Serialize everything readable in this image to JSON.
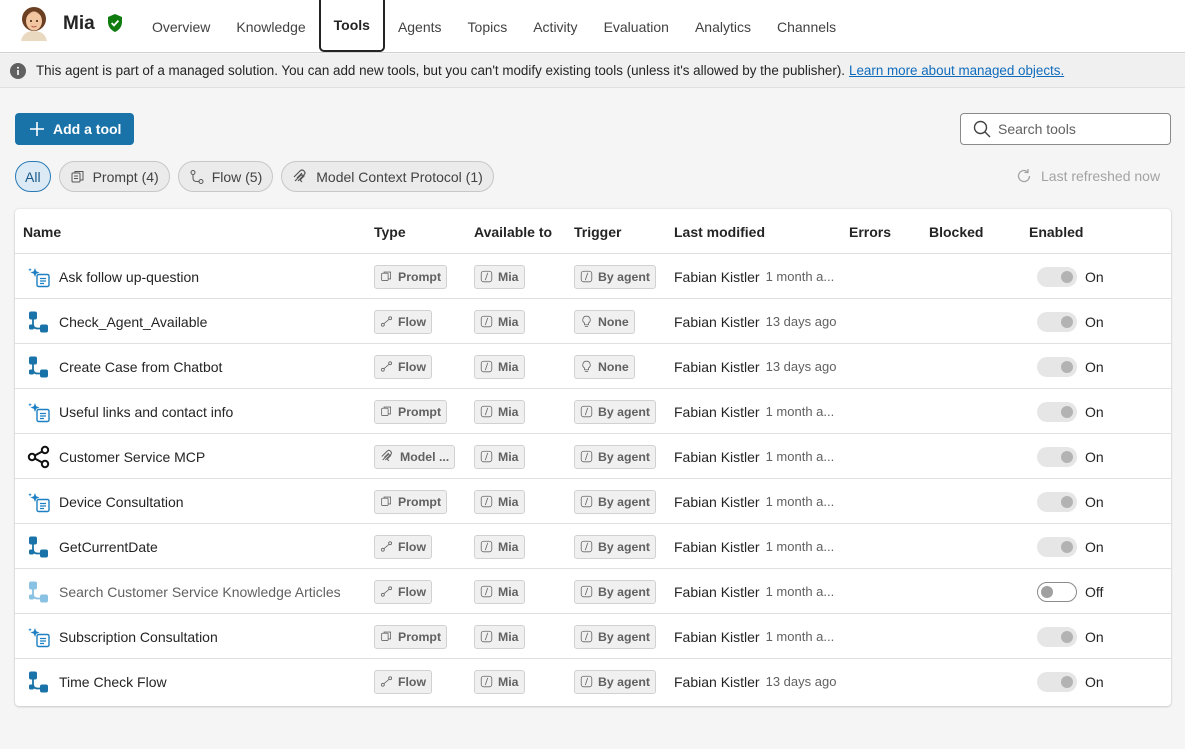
{
  "header": {
    "agent_name": "Mia",
    "tabs": [
      {
        "label": "Overview"
      },
      {
        "label": "Knowledge"
      },
      {
        "label": "Tools",
        "active": true
      },
      {
        "label": "Agents"
      },
      {
        "label": "Topics"
      },
      {
        "label": "Activity"
      },
      {
        "label": "Evaluation"
      },
      {
        "label": "Analytics"
      },
      {
        "label": "Channels"
      }
    ]
  },
  "banner": {
    "text": "This agent is part of a managed solution. You can add new tools, but you can't modify existing tools (unless it's allowed by the publisher).",
    "link": "Learn more about managed objects."
  },
  "toolbar": {
    "add_label": "Add a tool",
    "search_placeholder": "Search tools",
    "refreshed": "Last refreshed now"
  },
  "filters": {
    "all": "All",
    "prompt": "Prompt (4)",
    "flow": "Flow (5)",
    "mcp": "Model Context Protocol (1)"
  },
  "table": {
    "columns": {
      "name": "Name",
      "type": "Type",
      "available": "Available to",
      "trigger": "Trigger",
      "modified": "Last modified",
      "errors": "Errors",
      "blocked": "Blocked",
      "enabled": "Enabled"
    },
    "rows": [
      {
        "icon": "prompt-icon",
        "name": "Ask follow up-question",
        "type": "Prompt",
        "available": "Mia",
        "trigger": "By agent",
        "modified_by": "Fabian Kistler",
        "modified_ago": "1 month a...",
        "enabled": "On"
      },
      {
        "icon": "flow-icon",
        "name": "Check_Agent_Available",
        "type": "Flow",
        "available": "Mia",
        "trigger": "None",
        "modified_by": "Fabian Kistler",
        "modified_ago": "13 days ago",
        "enabled": "On"
      },
      {
        "icon": "flow-icon",
        "name": "Create Case from Chatbot",
        "type": "Flow",
        "available": "Mia",
        "trigger": "None",
        "modified_by": "Fabian Kistler",
        "modified_ago": "13 days ago",
        "enabled": "On"
      },
      {
        "icon": "prompt-icon",
        "name": "Useful links and contact info",
        "type": "Prompt",
        "available": "Mia",
        "trigger": "By agent",
        "modified_by": "Fabian Kistler",
        "modified_ago": "1 month a...",
        "enabled": "On"
      },
      {
        "icon": "mcp-icon",
        "name": "Customer Service MCP",
        "type": "Model ...",
        "available": "Mia",
        "trigger": "By agent",
        "modified_by": "Fabian Kistler",
        "modified_ago": "1 month a...",
        "enabled": "On"
      },
      {
        "icon": "prompt-icon",
        "name": "Device Consultation",
        "type": "Prompt",
        "available": "Mia",
        "trigger": "By agent",
        "modified_by": "Fabian Kistler",
        "modified_ago": "1 month a...",
        "enabled": "On"
      },
      {
        "icon": "flow-icon",
        "name": "GetCurrentDate",
        "type": "Flow",
        "available": "Mia",
        "trigger": "By agent",
        "modified_by": "Fabian Kistler",
        "modified_ago": "1 month a...",
        "enabled": "On"
      },
      {
        "icon": "flow-icon",
        "name": "Search Customer Service Knowledge Articles",
        "type": "Flow",
        "available": "Mia",
        "trigger": "By agent",
        "modified_by": "Fabian Kistler",
        "modified_ago": "1 month a...",
        "enabled": "Off",
        "disabled": true
      },
      {
        "icon": "prompt-icon",
        "name": "Subscription Consultation",
        "type": "Prompt",
        "available": "Mia",
        "trigger": "By agent",
        "modified_by": "Fabian Kistler",
        "modified_ago": "1 month a...",
        "enabled": "On"
      },
      {
        "icon": "flow-icon",
        "name": "Time Check Flow",
        "type": "Flow",
        "available": "Mia",
        "trigger": "By agent",
        "modified_by": "Fabian Kistler",
        "modified_ago": "13 days ago",
        "enabled": "On"
      }
    ]
  },
  "colors": {
    "accent": "#1a73a8",
    "verified": "#107c10",
    "link": "#0f6cbd"
  }
}
